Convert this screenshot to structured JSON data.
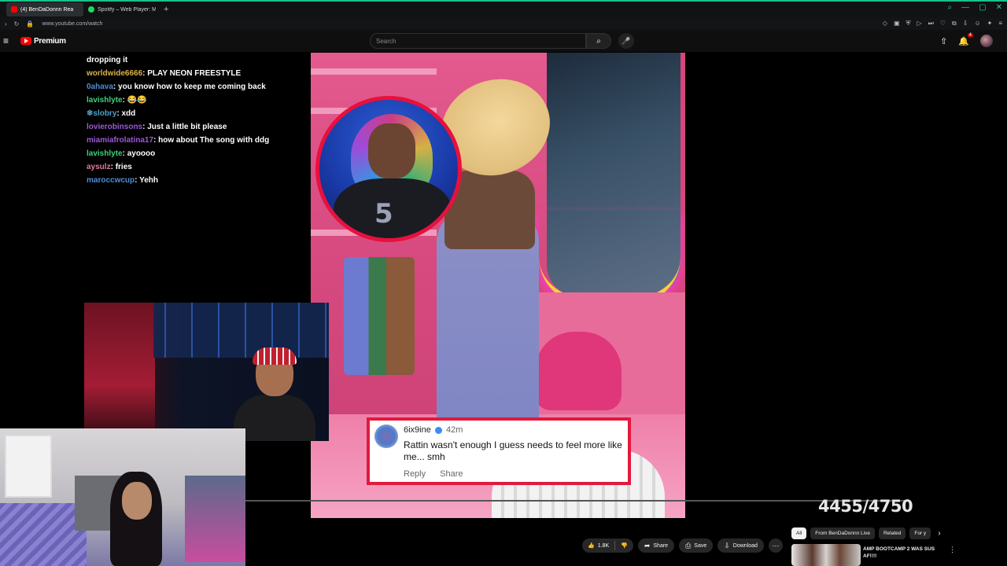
{
  "browser": {
    "tabs": [
      {
        "label": "(4) BenDaDonnn Rea",
        "favicon_color": "#ff0000"
      },
      {
        "label": "Spotify – Web Player: Mu",
        "favicon_color": "#1ed760"
      }
    ],
    "url": "www.youtube.com/watch"
  },
  "youtube": {
    "logo_text": "Premium",
    "search_placeholder": "Search",
    "notification_count": "4"
  },
  "chat": [
    {
      "user": "",
      "message": "dropping it",
      "color": "u-yellow"
    },
    {
      "user": "worldwide6666",
      "message": "PLAY NEON FREESTYLE",
      "color": "u-yellow"
    },
    {
      "user": "0ahava",
      "message": "you know how to keep me coming back",
      "color": "u-blue"
    },
    {
      "user": "lavishlyte",
      "message": "😂😂",
      "color": "u-green"
    },
    {
      "user": "❄slobry",
      "message": "xdd",
      "color": "u-teal"
    },
    {
      "user": "lovierobinsons",
      "message": "Just a little bit please",
      "color": "u-purple"
    },
    {
      "user": "miamiafrolatina17",
      "message": "how about The song with ddg",
      "color": "u-purple"
    },
    {
      "user": "lavishlyte",
      "message": "ayoooo",
      "color": "u-green"
    },
    {
      "user": "aysulz",
      "message": "fries",
      "color": "u-pink"
    },
    {
      "user": "maroccwcup",
      "message": "Yehh",
      "color": "u-blue"
    }
  ],
  "video": {
    "comment": {
      "username": "6ix9ine",
      "time": "42m",
      "body": "Rattin wasn't enough I guess needs to feel more like me... smh",
      "reply_label": "Reply",
      "share_label": "Share"
    },
    "jersey_number": "5",
    "counter": "4455/4750"
  },
  "actions": {
    "likes": "1.8K",
    "share": "Share",
    "save": "Save",
    "download": "Download"
  },
  "chips": [
    "All",
    "From BenDaDonnn Live",
    "Related",
    "For y"
  ],
  "recommended": {
    "title": "AMP BOOTCAMP 2 WAS SUS AF!!!!"
  },
  "colors": {
    "accent": "#18c28a",
    "youtube_red": "#ff0000",
    "comment_border": "#e2193d"
  }
}
